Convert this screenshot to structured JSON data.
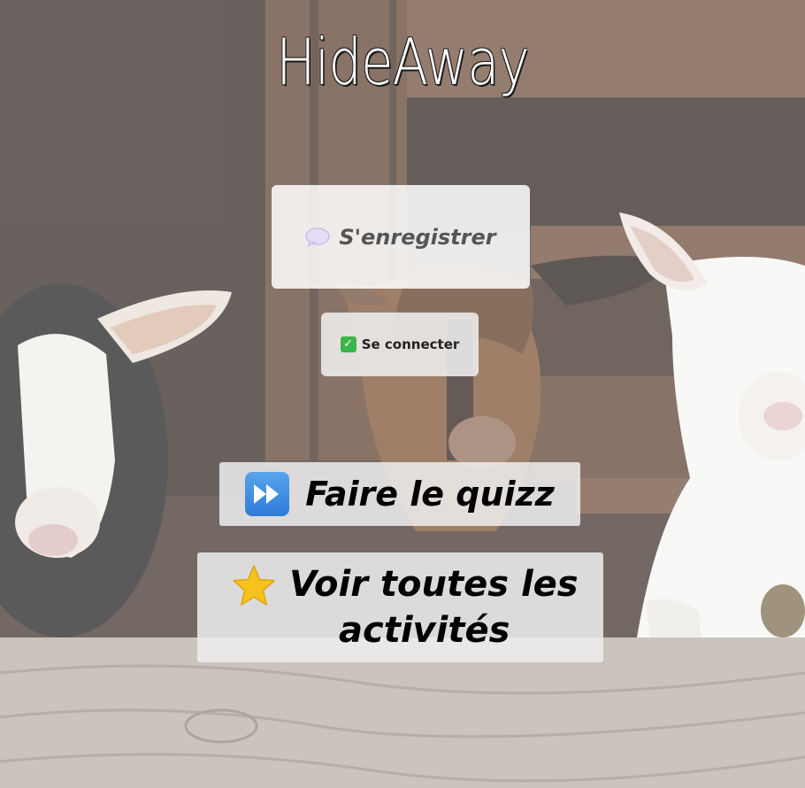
{
  "app": {
    "title": "HideAway"
  },
  "buttons": {
    "register": {
      "label": "S'enregistrer",
      "icon": "speech-bubble-icon"
    },
    "login": {
      "label": "Se connecter",
      "icon": "check-mark-icon"
    },
    "quiz": {
      "label": "Faire le quizz",
      "icon": "fast-forward-icon"
    },
    "activities": {
      "label_line1": "Voir toutes les",
      "label_line2": "activités",
      "icon": "star-icon"
    }
  },
  "background": {
    "subject": "goats-photo",
    "overlay_color": "#ffffff"
  }
}
